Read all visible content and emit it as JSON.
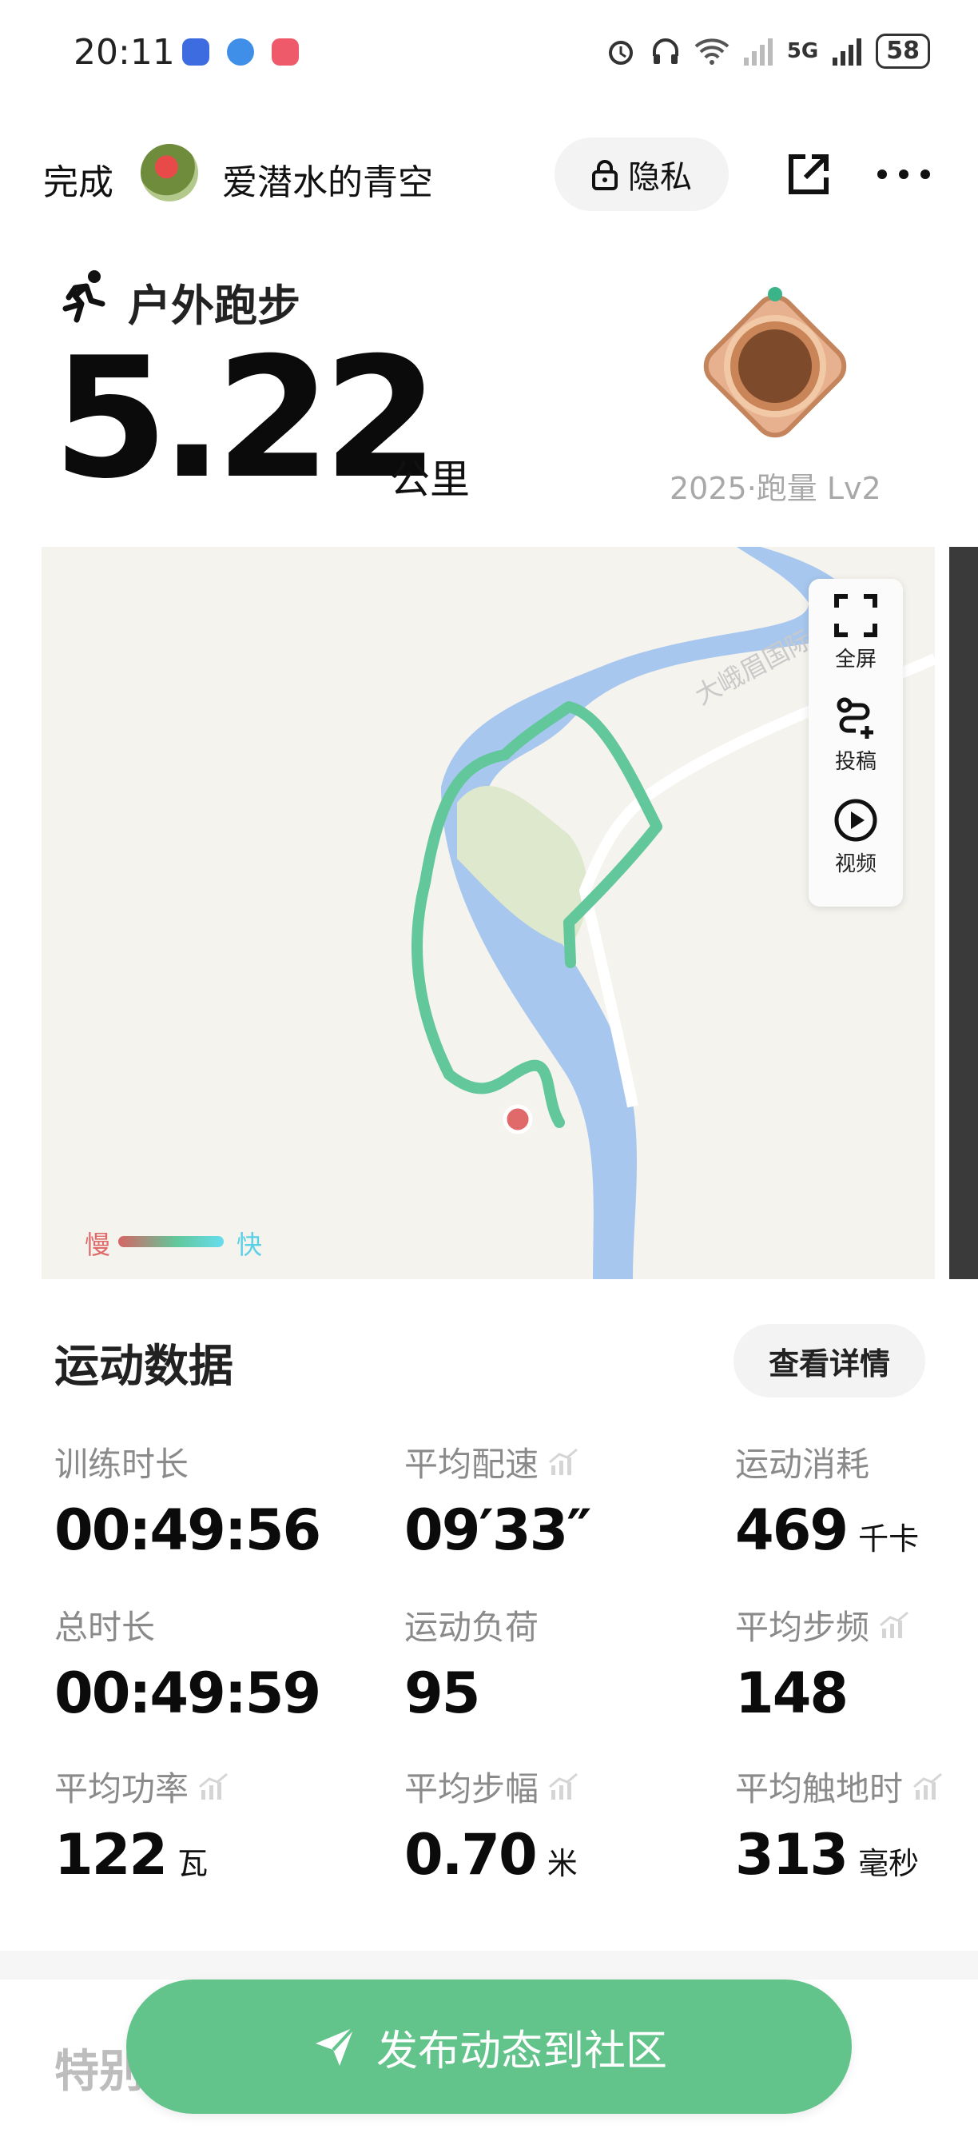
{
  "status_bar": {
    "time": "20:11",
    "network": "5G",
    "battery": "58",
    "icons": [
      "alarm-icon",
      "headphone-icon",
      "wifi-icon",
      "signal-icon"
    ]
  },
  "header": {
    "done_label": "完成",
    "username": "爱潜水的青空",
    "privacy_label": "隐私"
  },
  "activity": {
    "type": "户外跑步",
    "distance": "5.22",
    "distance_unit": "公里",
    "medal_caption": "2025·跑量 Lv2"
  },
  "map": {
    "road_label": "大峨眉国际",
    "tools": [
      {
        "label": "全屏",
        "icon": "fullscreen-icon"
      },
      {
        "label": "投稿",
        "icon": "route-add-icon"
      },
      {
        "label": "视频",
        "icon": "play-icon"
      }
    ],
    "legend": {
      "slow": "慢",
      "fast": "快"
    },
    "colors": {
      "river": "#a7c7ef",
      "park": "#dde8cc",
      "route": "#62c79a",
      "start": "#e06a6a"
    }
  },
  "stats": {
    "title": "运动数据",
    "details_label": "查看详情",
    "items": [
      {
        "label": "训练时长",
        "value": "00:49:56",
        "unit": "",
        "trend": false
      },
      {
        "label": "平均配速",
        "value": "09′33″",
        "unit": "",
        "trend": true
      },
      {
        "label": "运动消耗",
        "value": "469",
        "unit": "千卡",
        "trend": false
      },
      {
        "label": "总时长",
        "value": "00:49:59",
        "unit": "",
        "trend": false
      },
      {
        "label": "运动负荷",
        "value": "95",
        "unit": "",
        "trend": false
      },
      {
        "label": "平均步频",
        "value": "148",
        "unit": "",
        "trend": true
      },
      {
        "label": "平均功率",
        "value": "122",
        "unit": "瓦",
        "trend": true
      },
      {
        "label": "平均步幅",
        "value": "0.70",
        "unit": "米",
        "trend": true
      },
      {
        "label": "平均触地时",
        "value": "313",
        "unit": "毫秒",
        "trend": true
      }
    ]
  },
  "bottom": {
    "next_section_title": "特别",
    "publish_label": "发布动态到社区"
  }
}
